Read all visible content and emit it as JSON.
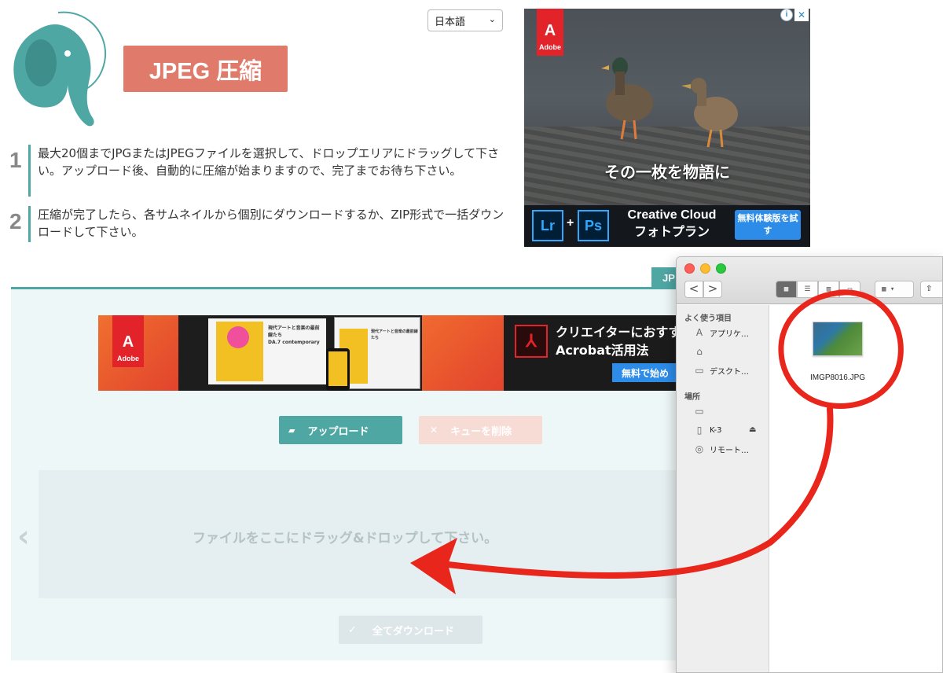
{
  "header": {
    "app_title": "JPEG 圧縮",
    "language": "日本語",
    "logo_icon": "elephant-logo-icon"
  },
  "steps": [
    {
      "number": "1",
      "text": "最大20個までJPGまたはJPEGファイルを選択して、ドロップエリアにドラッグして下さい。アップロード後、自動的に圧縮が始まりますので、完了までお待ち下さい。"
    },
    {
      "number": "2",
      "text": "圧縮が完了したら、各サムネイルから個別にダウンロードするか、ZIP形式で一括ダウンロードして下さい。"
    }
  ],
  "ad_top": {
    "brand": "Adobe",
    "caption": "その一枚を物語に",
    "product_1": "Lr",
    "product_2": "Ps",
    "plus": "+",
    "headline_1": "Creative Cloud",
    "headline_2": "フォトプラン",
    "cta": "無料体験版を試す",
    "info_icon": "info-icon",
    "close_icon": "close-icon"
  },
  "tab": {
    "label": "JP"
  },
  "banner_ad": {
    "brand": "Adobe",
    "headline_1": "クリエイターにおすす",
    "headline_2": "Acrobat活用法",
    "cta": "無料で始め",
    "doc_title": "現代アートと音楽の最前線たち",
    "doc_sub": "DA.7 contemporary"
  },
  "buttons": {
    "upload": "アップロード",
    "clear_queue": "キューを削除",
    "download_all": "全てダウンロード"
  },
  "dropzone": {
    "message": "ファイルをここにドラッグ&ドロップして下さい。",
    "prev_arrow": "‹"
  },
  "finder": {
    "favorites_header": "よく使う項目",
    "favorites": [
      "アプリケ…",
      "",
      "デスクト…"
    ],
    "locations_header": "場所",
    "locations": [
      "",
      "K-3",
      "リモート…"
    ],
    "file": {
      "name": "IMGP8016.JPG"
    },
    "nav_back": "<",
    "nav_forward": ">",
    "arrange_label": "▾"
  },
  "colors": {
    "accent": "#4fa7a4",
    "title_bg": "#e07a6a",
    "annotation": "#e8261c",
    "ad_cta": "#2d8ce8"
  }
}
